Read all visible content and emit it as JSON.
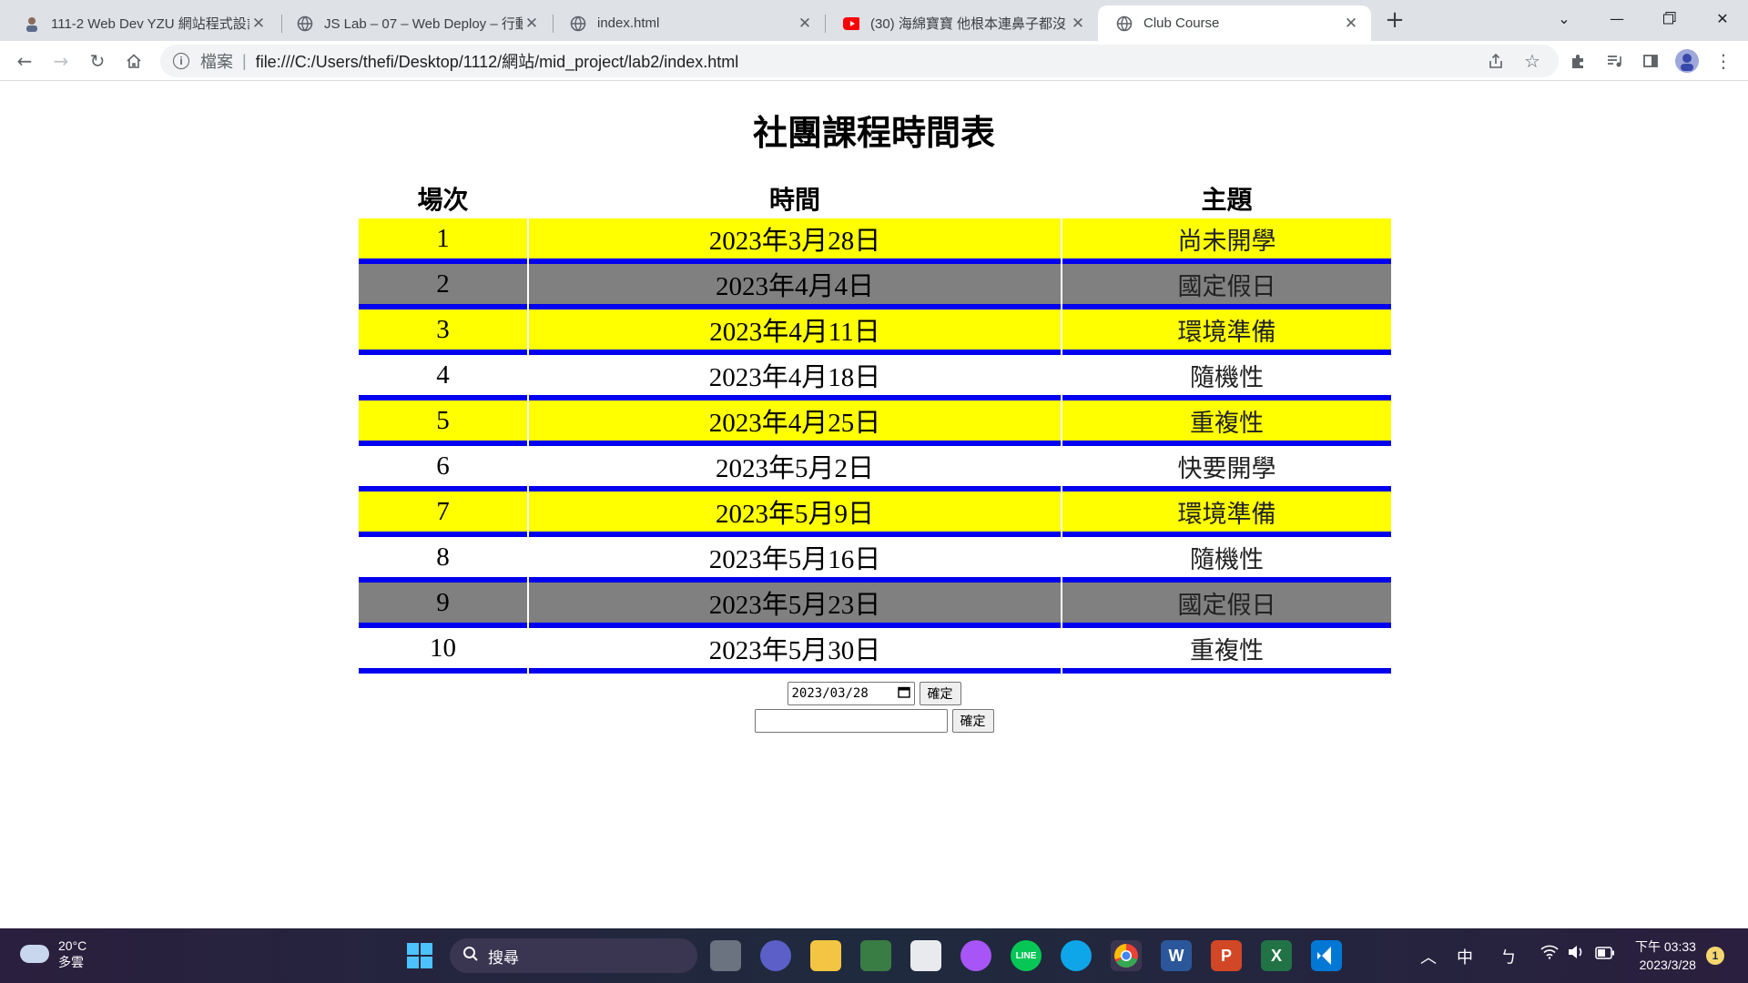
{
  "browser": {
    "tabs": [
      {
        "title": "111-2 Web Dev YZU 網站程式設計",
        "active": false,
        "favicon": "user-avatar-icon"
      },
      {
        "title": "JS Lab – 07 – Web Deploy – 行動",
        "active": false,
        "favicon": "globe-icon"
      },
      {
        "title": "index.html",
        "active": false,
        "favicon": "globe-icon"
      },
      {
        "title": "(30) 海綿寶寶 他根本連鼻子都沒",
        "active": false,
        "favicon": "youtube-icon"
      },
      {
        "title": "Club Course",
        "active": true,
        "favicon": "globe-icon"
      }
    ],
    "address": {
      "scheme_label": "檔案",
      "url": "file:///C:/Users/thefi/Desktop/1112/網站/mid_project/lab2/index.html"
    }
  },
  "page": {
    "title": "社團課程時間表",
    "headers": {
      "session": "場次",
      "time": "時間",
      "topic": "主題"
    },
    "rows": [
      {
        "session": "1",
        "date": "2023年3月28日",
        "topic": "尚未開學",
        "color": "#ffff00"
      },
      {
        "session": "2",
        "date": "2023年4月4日",
        "topic": "國定假日",
        "color": "#808080"
      },
      {
        "session": "3",
        "date": "2023年4月11日",
        "topic": "環境準備",
        "color": "#ffff00"
      },
      {
        "session": "4",
        "date": "2023年4月18日",
        "topic": "隨機性",
        "color": "#ffffff"
      },
      {
        "session": "5",
        "date": "2023年4月25日",
        "topic": "重複性",
        "color": "#ffff00"
      },
      {
        "session": "6",
        "date": "2023年5月2日",
        "topic": "快要開學",
        "color": "#ffffff"
      },
      {
        "session": "7",
        "date": "2023年5月9日",
        "topic": "環境準備",
        "color": "#ffff00"
      },
      {
        "session": "8",
        "date": "2023年5月16日",
        "topic": "隨機性",
        "color": "#ffffff"
      },
      {
        "session": "9",
        "date": "2023年5月23日",
        "topic": "國定假日",
        "color": "#808080"
      },
      {
        "session": "10",
        "date": "2023年5月30日",
        "topic": "重複性",
        "color": "#ffffff"
      }
    ],
    "row_border_color": "#0000ee",
    "date_form": {
      "value": "2023/03/28",
      "button": "確定"
    },
    "text_form": {
      "value": "",
      "button": "確定"
    }
  },
  "taskbar": {
    "weather": {
      "temp": "20°C",
      "condition": "多雲"
    },
    "search_label": "搜尋",
    "ime_label": "中",
    "ime_mode": "ㄅ",
    "clock": {
      "time": "下午 03:33",
      "date": "2023/3/28"
    },
    "notification_count": "1"
  }
}
